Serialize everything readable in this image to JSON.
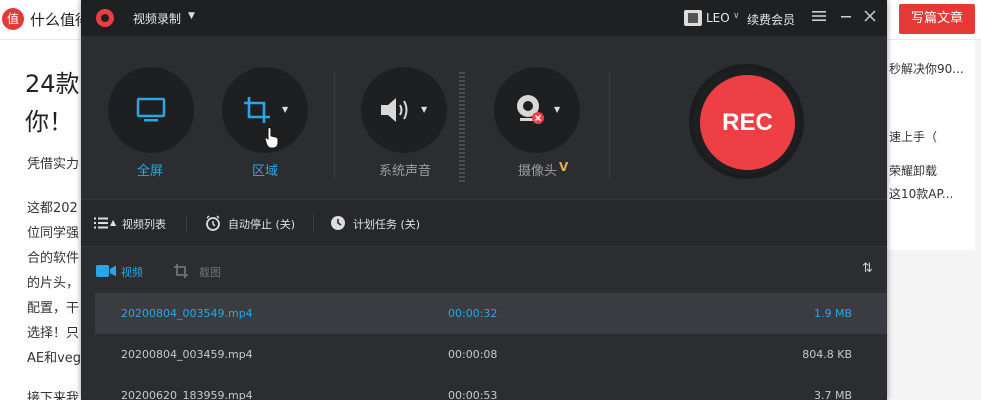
{
  "background_page": {
    "logo_char": "值",
    "site_name": "什么值得",
    "write_button": "写篇文章",
    "title_lines": [
      "24款",
      "你！"
    ],
    "body_lines": [
      "凭借实力",
      "这都202",
      "位同学强",
      "合的软件",
      "的片头，",
      "配置，干",
      "选择！只",
      "AE和veg",
      "接下来我"
    ],
    "side_lines": [
      "秒解决你90...",
      "速上手（",
      "荣耀卸载",
      "这10款AP..."
    ]
  },
  "recorder": {
    "title": "视频录制",
    "user_name": "LEO",
    "renew_label": "续费会员",
    "controls": [
      {
        "label": "全屏",
        "icon": "monitor-icon",
        "active": true
      },
      {
        "label": "区域",
        "icon": "crop-icon",
        "active": true
      },
      {
        "label": "系统声音",
        "icon": "speaker-icon",
        "active": false
      },
      {
        "label": "摄像头",
        "icon": "webcam-icon",
        "active": false
      }
    ],
    "webcam_badge": "V",
    "rec_label": "REC",
    "toolbar": {
      "video_list": "视频列表",
      "auto_stop": "自动停止 (关)",
      "schedule": "计划任务 (关)"
    },
    "tabs": {
      "video": "视频",
      "screenshot": "截图"
    },
    "files": [
      {
        "name": "20200804_003549.mp4",
        "duration": "00:00:32",
        "size": "1.9 MB",
        "selected": true
      },
      {
        "name": "20200804_003459.mp4",
        "duration": "00:00:08",
        "size": "804.8 KB",
        "selected": false
      },
      {
        "name": "20200620_183959.mp4",
        "duration": "00:00:53",
        "size": "3.7 MB",
        "selected": false
      }
    ],
    "colors": {
      "accent": "#2aa6e6",
      "rec": "#ee3f45",
      "gold": "#e8b04a"
    }
  }
}
